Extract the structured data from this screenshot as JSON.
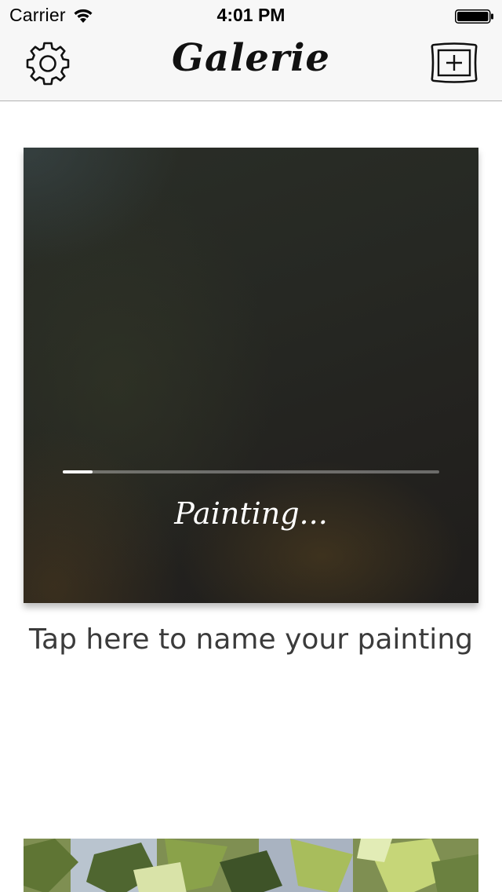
{
  "status_bar": {
    "carrier": "Carrier",
    "time": "4:01 PM"
  },
  "nav": {
    "title": "Galerie",
    "left_icon": "gear-icon",
    "right_icon": "add-frame-icon"
  },
  "painting": {
    "progress": 0.08,
    "status_text": "Painting...",
    "name_prompt": "Tap here to name your painting"
  },
  "colors": {
    "nav_background": "#f7f7f7",
    "progress_fill": "#ffffff",
    "prompt_text": "#3b3b3b"
  }
}
